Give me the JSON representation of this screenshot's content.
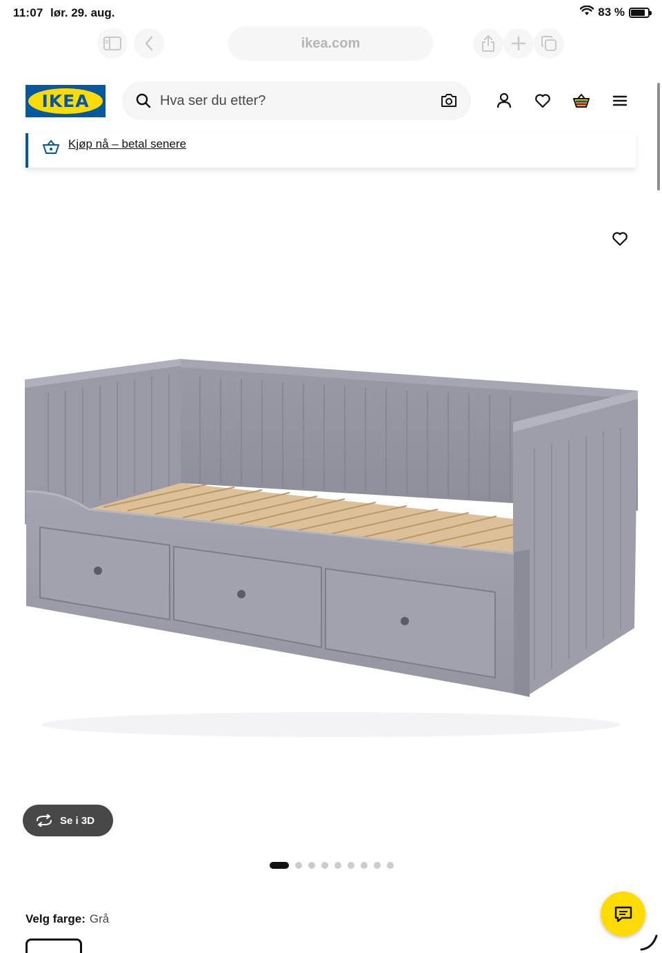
{
  "status_bar": {
    "time": "11:07",
    "date": "lør. 29. aug.",
    "battery": "83 %",
    "battery_level": 0.83,
    "icons": [
      "wifi-icon",
      "battery-icon"
    ]
  },
  "browser": {
    "url": "ikea.com",
    "icons": [
      "sidebar-icon",
      "back-icon",
      "share-icon",
      "new-tab-icon",
      "tabs-icon"
    ]
  },
  "header": {
    "logo_text": "IKEA",
    "search_placeholder": "Hva ser du etter?",
    "icons": [
      "search-icon",
      "camera-icon",
      "account-icon",
      "heart-icon",
      "cart-icon",
      "menu-icon"
    ]
  },
  "banner": {
    "link_text": "Kjøp nå – betal senere",
    "icon": "basket-icon"
  },
  "product": {
    "view3d_label": "Se i 3D",
    "gallery_dot_count": 9,
    "active_dot_index": 0,
    "color_label": "Velg farge:",
    "color_value": "Grå"
  },
  "colors": {
    "ikea_blue": "#0058a3",
    "ikea_yellow": "#ffdb00",
    "bed_gray": "#9b9ba8",
    "slat_wood": "#d8b98a"
  }
}
